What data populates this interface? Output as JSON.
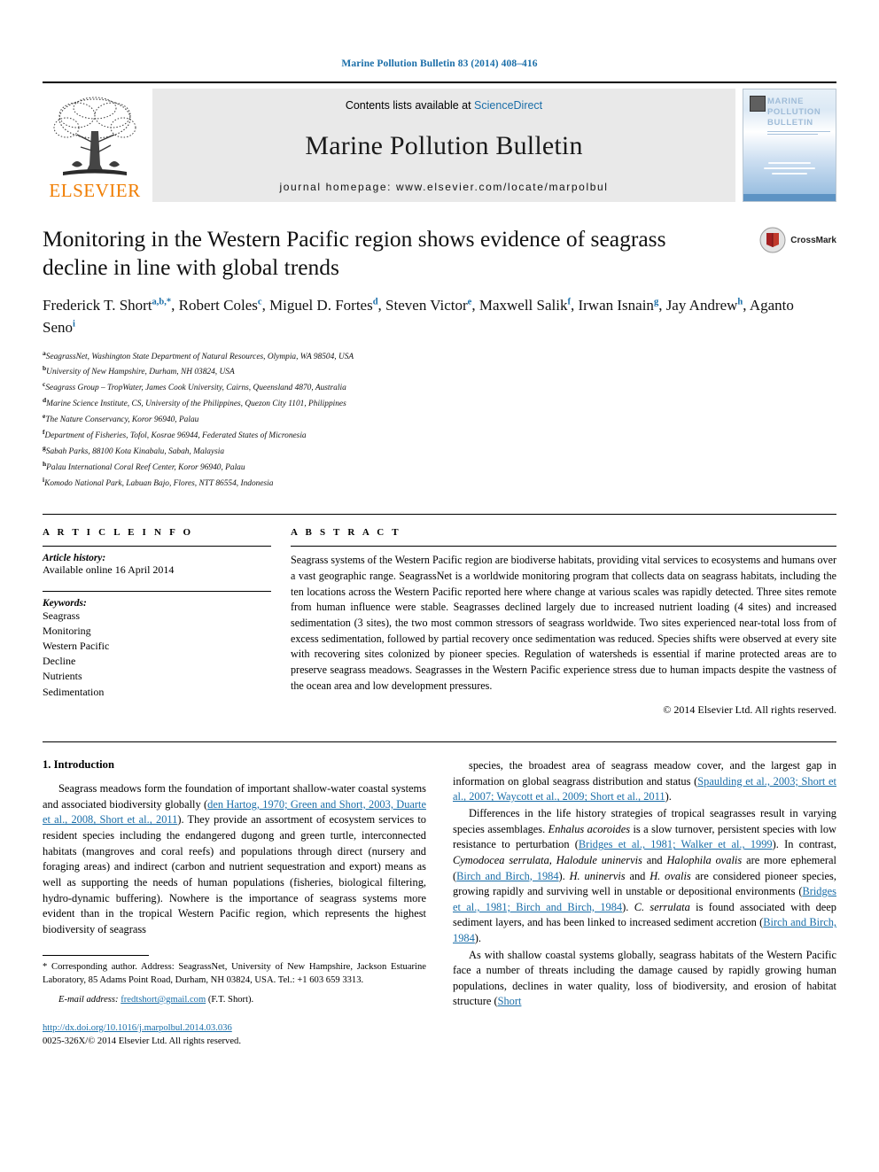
{
  "running_head": "Marine Pollution Bulletin 83 (2014) 408–416",
  "masthead": {
    "publisher_name": "ELSEVIER",
    "contents_prefix": "Contents lists available at ",
    "sciencedirect": "ScienceDirect",
    "journal_title": "Marine Pollution Bulletin",
    "homepage": "journal homepage: www.elsevier.com/locate/marpolbul",
    "cover_title_line1": "MARINE",
    "cover_title_line2": "POLLUTION",
    "cover_title_line3": "BULLETIN"
  },
  "article": {
    "title": "Monitoring in the Western Pacific region shows evidence of seagrass decline in line with global trends",
    "crossmark_label": "CrossMark",
    "authors": [
      {
        "name": "Frederick T. Short",
        "sup": "a,b,*"
      },
      {
        "name": "Robert Coles",
        "sup": "c"
      },
      {
        "name": "Miguel D. Fortes",
        "sup": "d"
      },
      {
        "name": "Steven Victor",
        "sup": "e"
      },
      {
        "name": "Maxwell Salik",
        "sup": "f"
      },
      {
        "name": "Irwan Isnain",
        "sup": "g"
      },
      {
        "name": "Jay Andrew",
        "sup": "h"
      },
      {
        "name": "Aganto Seno",
        "sup": "i"
      }
    ],
    "affiliations": [
      {
        "mark": "a",
        "text": "SeagrassNet, Washington State Department of Natural Resources, Olympia, WA 98504, USA"
      },
      {
        "mark": "b",
        "text": "University of New Hampshire, Durham, NH 03824, USA"
      },
      {
        "mark": "c",
        "text": "Seagrass Group – TropWater, James Cook University, Cairns, Queensland 4870, Australia"
      },
      {
        "mark": "d",
        "text": "Marine Science Institute, CS, University of the Philippines, Quezon City 1101, Philippines"
      },
      {
        "mark": "e",
        "text": "The Nature Conservancy, Koror 96940, Palau"
      },
      {
        "mark": "f",
        "text": "Department of Fisheries, Tofol, Kosrae 96944, Federated States of Micronesia"
      },
      {
        "mark": "g",
        "text": "Sabah Parks, 88100 Kota Kinabalu, Sabah, Malaysia"
      },
      {
        "mark": "h",
        "text": "Palau International Coral Reef Center, Koror 96940, Palau"
      },
      {
        "mark": "i",
        "text": "Komodo National Park, Labuan Bajo, Flores, NTT 86554, Indonesia"
      }
    ]
  },
  "article_info": {
    "heading": "A R T I C L E    I N F O",
    "history_label": "Article history:",
    "history_value": "Available online 16 April 2014",
    "keywords_label": "Keywords:",
    "keywords": [
      "Seagrass",
      "Monitoring",
      "Western Pacific",
      "Decline",
      "Nutrients",
      "Sedimentation"
    ]
  },
  "abstract": {
    "heading": "A B S T R A C T",
    "text": "Seagrass systems of the Western Pacific region are biodiverse habitats, providing vital services to ecosystems and humans over a vast geographic range. SeagrassNet is a worldwide monitoring program that collects data on seagrass habitats, including the ten locations across the Western Pacific reported here where change at various scales was rapidly detected. Three sites remote from human influence were stable. Seagrasses declined largely due to increased nutrient loading (4 sites) and increased sedimentation (3 sites), the two most common stressors of seagrass worldwide. Two sites experienced near-total loss from of excess sedimentation, followed by partial recovery once sedimentation was reduced. Species shifts were observed at every site with recovering sites colonized by pioneer species. Regulation of watersheds is essential if marine protected areas are to preserve seagrass meadows. Seagrasses in the Western Pacific experience stress due to human impacts despite the vastness of the ocean area and low development pressures.",
    "copyright": "© 2014 Elsevier Ltd. All rights reserved."
  },
  "body": {
    "section_heading": "1. Introduction",
    "left_paragraphs": [
      [
        {
          "t": "Seagrass meadows form the foundation of important shallow-water coastal systems and associated biodiversity globally ("
        },
        {
          "t": "den Hartog, 1970; Green and Short, 2003, Duarte et al., 2008, Short et al., 2011",
          "k": "ref"
        },
        {
          "t": "). They provide an assortment of ecosystem services to resident species including the endangered dugong and green turtle, interconnected habitats (mangroves and coral reefs) and populations through direct (nursery and foraging areas) and indirect (carbon and nutrient sequestration and export) means as well as supporting the needs of human populations (fisheries, biological filtering, hydro-dynamic buffering). Nowhere is the importance of seagrass systems more evident than in the tropical Western Pacific region, which represents the highest biodiversity of seagrass"
        }
      ]
    ],
    "right_paragraphs": [
      [
        {
          "t": "species, the broadest area of seagrass meadow cover, and the largest gap in information on global seagrass distribution and status ("
        },
        {
          "t": "Spaulding et al., 2003; Short et al., 2007; Waycott et al., 2009; Short et al., 2011",
          "k": "ref"
        },
        {
          "t": ")."
        }
      ],
      [
        {
          "t": "Differences in the life history strategies of tropical seagrasses result in varying species assemblages. "
        },
        {
          "t": "Enhalus acoroides",
          "k": "sp"
        },
        {
          "t": " is a slow turnover, persistent species with low resistance to perturbation ("
        },
        {
          "t": "Bridges et al., 1981; Walker et al., 1999",
          "k": "ref"
        },
        {
          "t": "). In contrast, "
        },
        {
          "t": "Cymodocea serrulata, Halodule uninervis",
          "k": "sp"
        },
        {
          "t": " and "
        },
        {
          "t": "Halophila ovalis",
          "k": "sp"
        },
        {
          "t": " are more ephemeral ("
        },
        {
          "t": "Birch and Birch, 1984",
          "k": "ref"
        },
        {
          "t": "). "
        },
        {
          "t": "H. uninervis",
          "k": "sp"
        },
        {
          "t": " and "
        },
        {
          "t": "H. ovalis",
          "k": "sp"
        },
        {
          "t": " are considered pioneer species, growing rapidly and surviving well in unstable or depositional environments ("
        },
        {
          "t": "Bridges et al., 1981; Birch and Birch, 1984",
          "k": "ref"
        },
        {
          "t": "). "
        },
        {
          "t": "C. serrulata",
          "k": "sp"
        },
        {
          "t": " is found associated with deep sediment layers, and has been linked to increased sediment accretion ("
        },
        {
          "t": "Birch and Birch, 1984",
          "k": "ref"
        },
        {
          "t": ")."
        }
      ],
      [
        {
          "t": "As with shallow coastal systems globally, seagrass habitats of the Western Pacific face a number of threats including the damage caused by rapidly growing human populations, declines in water quality, loss of biodiversity, and erosion of habitat structure ("
        },
        {
          "t": "Short",
          "k": "ref"
        }
      ]
    ]
  },
  "footer": {
    "corresponding_note": "* Corresponding author. Address: SeagrassNet, University of New Hampshire, Jackson Estuarine Laboratory, 85 Adams Point Road, Durham, NH 03824, USA. Tel.: +1 603 659 3313.",
    "email_label": "E-mail address:",
    "email": "fredtshort@gmail.com",
    "email_suffix": "(F.T. Short).",
    "doi": "http://dx.doi.org/10.1016/j.marpolbul.2014.03.036",
    "issn_line": "0025-326X/© 2014 Elsevier Ltd. All rights reserved."
  },
  "colors": {
    "link_blue": "#1a6ea8",
    "elsevier_orange": "#f07d00",
    "banner_grey": "#e9e9e9"
  }
}
